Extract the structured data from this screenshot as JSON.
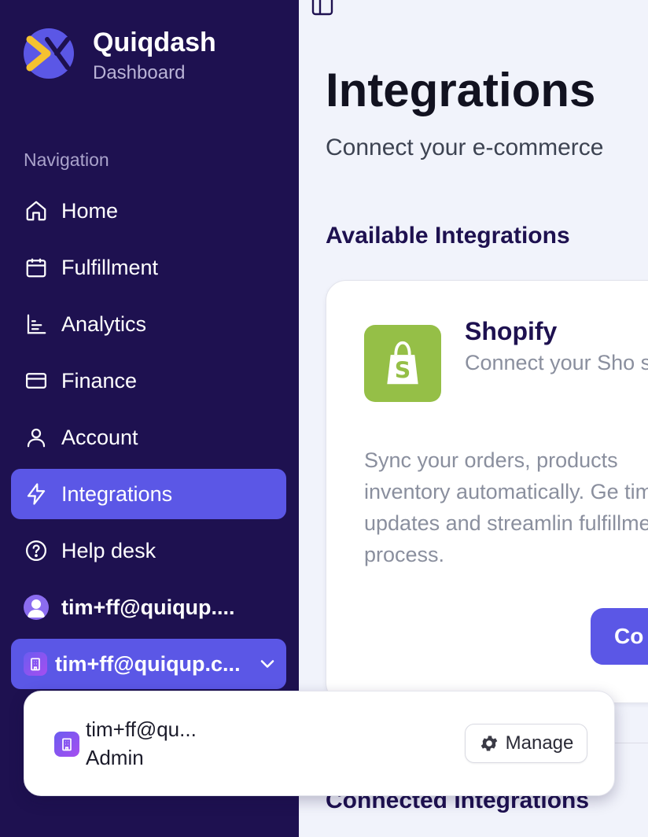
{
  "brand": {
    "name": "Quiqdash",
    "subtitle": "Dashboard"
  },
  "navigation": {
    "heading": "Navigation",
    "items": [
      {
        "label": "Home",
        "icon": "home-icon"
      },
      {
        "label": "Fulfillment",
        "icon": "calendar-icon"
      },
      {
        "label": "Analytics",
        "icon": "chart-icon"
      },
      {
        "label": "Finance",
        "icon": "credit-card-icon"
      },
      {
        "label": "Account",
        "icon": "user-icon"
      },
      {
        "label": "Integrations",
        "icon": "lightning-icon",
        "active": true
      },
      {
        "label": "Help desk",
        "icon": "help-circle-icon"
      }
    ]
  },
  "user": {
    "email": "tim+ff@quiqup...."
  },
  "org_switcher": {
    "label": "tim+ff@quiqup.c..."
  },
  "org_popover": {
    "name": "tim+ff@qu...",
    "role": "Admin",
    "manage_label": "Manage"
  },
  "main": {
    "title": "Integrations",
    "subtitle": "Connect your e-commerce",
    "available_heading": "Available Integrations",
    "connected_heading": "Connected Integrations",
    "shopify": {
      "name": "Shopify",
      "tagline": "Connect your Sho store.",
      "description": "Sync your orders, products inventory automatically. Ge time updates and streamlin fulfillment process.",
      "button_label": "Co"
    }
  },
  "colors": {
    "sidebar_bg": "#1e1150",
    "accent": "#5b57e6",
    "shopify_green": "#95bf47"
  }
}
